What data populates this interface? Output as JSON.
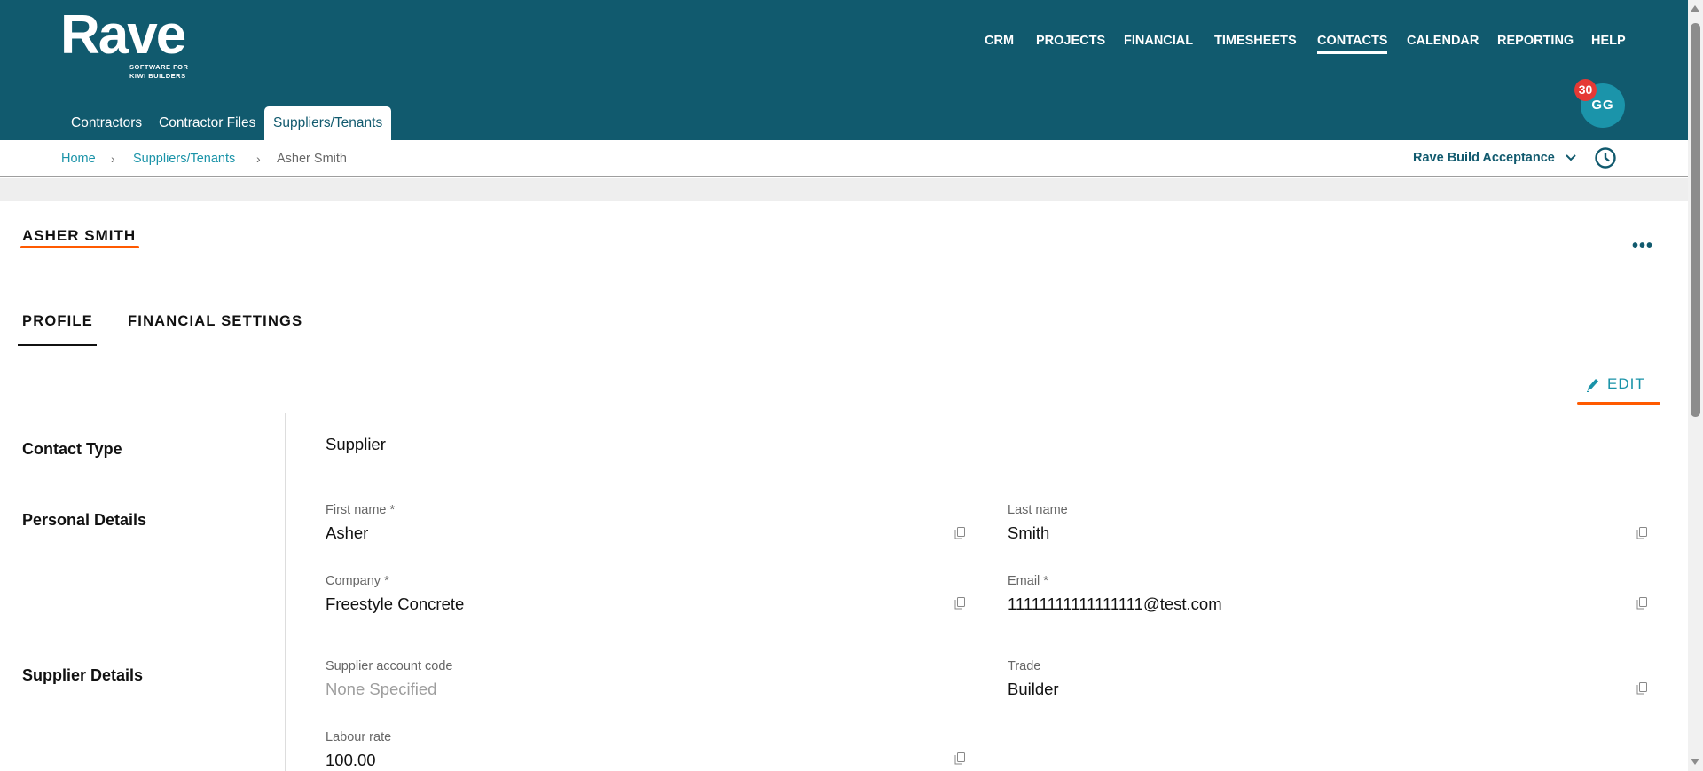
{
  "brand": {
    "logo": "Rave",
    "tagline_line1": "SOFTWARE FOR",
    "tagline_line2": "KIWI BUILDERS"
  },
  "topnav": [
    {
      "label": "CRM"
    },
    {
      "label": "PROJECTS"
    },
    {
      "label": "FINANCIAL"
    },
    {
      "label": "TIMESHEETS"
    },
    {
      "label": "CONTACTS",
      "active": true
    },
    {
      "label": "CALENDAR"
    },
    {
      "label": "REPORTING"
    },
    {
      "label": "HELP"
    }
  ],
  "subnav": [
    {
      "label": "Contractors"
    },
    {
      "label": "Contractor Files"
    },
    {
      "label": "Suppliers/Tenants",
      "active": true
    }
  ],
  "user": {
    "initials": "GG",
    "notifications": "30"
  },
  "breadcrumb": [
    "Home",
    "Suppliers/Tenants",
    "Asher Smith"
  ],
  "project_selector": "Rave Build Acceptance",
  "contact": {
    "name": "ASHER SMITH"
  },
  "tabs": [
    {
      "label": "PROFILE",
      "active": true
    },
    {
      "label": "FINANCIAL SETTINGS"
    }
  ],
  "edit_label": "EDIT",
  "sections": {
    "contact_type": "Contact Type",
    "personal": "Personal Details",
    "supplier": "Supplier Details"
  },
  "fields": {
    "contact_type": "Supplier",
    "first_name": {
      "label": "First name *",
      "value": "Asher"
    },
    "last_name": {
      "label": "Last name",
      "value": "Smith"
    },
    "company": {
      "label": "Company *",
      "value": "Freestyle Concrete"
    },
    "email": {
      "label": "Email *",
      "value": "11111111111111111@test.com"
    },
    "supplier_code": {
      "label": "Supplier account code",
      "value": "None Specified"
    },
    "trade": {
      "label": "Trade",
      "value": "Builder"
    },
    "labour_rate": {
      "label": "Labour rate",
      "value": "100.00"
    }
  },
  "colors": {
    "header": "#115a6e",
    "accent": "#1a93a8",
    "highlight": "#ff5a00",
    "badge": "#e53935"
  }
}
